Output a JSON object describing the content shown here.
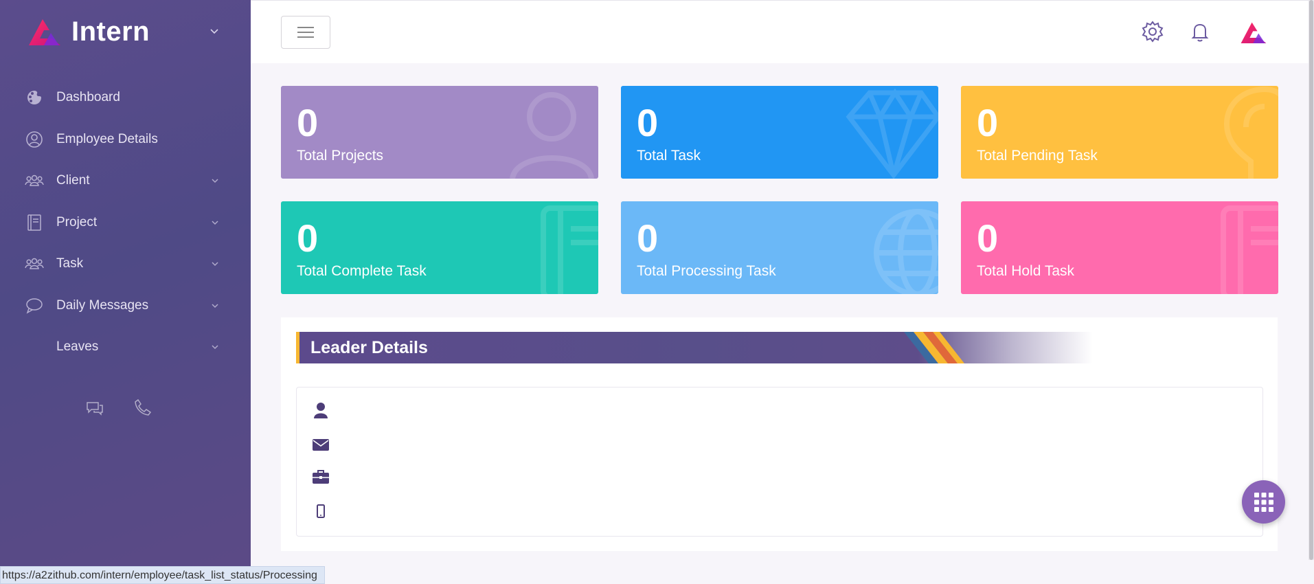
{
  "sidebar": {
    "brand": "Intern",
    "items": [
      {
        "label": "Dashboard",
        "icon": "palette-icon",
        "expandable": false
      },
      {
        "label": "Employee Details",
        "icon": "user-circle-icon",
        "expandable": false
      },
      {
        "label": "Client",
        "icon": "users-icon",
        "expandable": true
      },
      {
        "label": "Project",
        "icon": "book-icon",
        "expandable": true
      },
      {
        "label": "Task",
        "icon": "users-icon",
        "expandable": true
      },
      {
        "label": "Daily Messages",
        "icon": "message-icon",
        "expandable": true
      },
      {
        "label": "Leaves",
        "icon": "",
        "expandable": true
      }
    ]
  },
  "cards": [
    {
      "value": "0",
      "title": "Total Projects",
      "color": "#a28ac6",
      "icon": "user-icon"
    },
    {
      "value": "0",
      "title": "Total Task",
      "color": "#2196f3",
      "icon": "diamond-icon"
    },
    {
      "value": "0",
      "title": "Total Pending Task",
      "color": "#ffc040",
      "icon": "lightbulb-icon"
    },
    {
      "value": "0",
      "title": "Total Complete Task",
      "color": "#1ec8b5",
      "icon": "book-icon"
    },
    {
      "value": "0",
      "title": "Total Processing Task",
      "color": "#6bb8f7",
      "icon": "globe-icon"
    },
    {
      "value": "0",
      "title": "Total Hold Task",
      "color": "#ff6bad",
      "icon": "book-icon"
    }
  ],
  "leader": {
    "title": "Leader Details"
  },
  "status_url": "https://a2zithub.com/intern/employee/task_list_status/Processing"
}
